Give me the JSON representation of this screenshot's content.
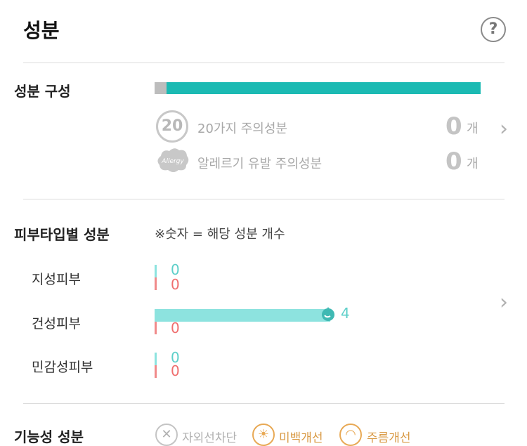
{
  "header": {
    "title": "성분",
    "help_label": "?"
  },
  "composition": {
    "title": "성분 구성",
    "warning20": {
      "badge": "20",
      "label": "20가지 주의성분",
      "count": "0",
      "unit": "개"
    },
    "allergy": {
      "badge": "Allergy",
      "label": "알레르기 유발 주의성분",
      "count": "0",
      "unit": "개"
    },
    "chevron": "›"
  },
  "skin_type": {
    "title": "피부타입별 성분",
    "note": "※숫자 = 해당 성분 개수",
    "rows": [
      {
        "label": "지성피부",
        "good": "0",
        "bad": "0"
      },
      {
        "label": "건성피부",
        "good": "4",
        "bad": "0"
      },
      {
        "label": "민감성피부",
        "good": "0",
        "bad": "0"
      }
    ],
    "chevron": "›"
  },
  "functional": {
    "title": "기능성 성분",
    "items": [
      {
        "label": "자외선차단",
        "icon": "✕"
      },
      {
        "label": "미백개선",
        "icon": "☀"
      },
      {
        "label": "주름개선",
        "icon": "◠"
      }
    ]
  },
  "colors": {
    "teal": "#1bbab3",
    "light_teal": "#8de3df",
    "red": "#f08a8a",
    "gray": "#bdbdbd",
    "orange": "#e8a955"
  }
}
